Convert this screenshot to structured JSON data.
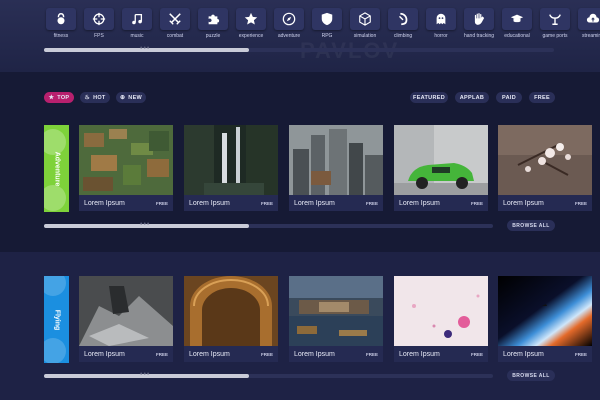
{
  "topbar": {
    "background_text": "PAVLOV",
    "categories": [
      {
        "label": "fitness",
        "icon": "kettlebell-icon"
      },
      {
        "label": "FPS",
        "icon": "crosshair-icon"
      },
      {
        "label": "music",
        "icon": "music-note-icon"
      },
      {
        "label": "combat",
        "icon": "swords-icon"
      },
      {
        "label": "puzzle",
        "icon": "puzzle-icon"
      },
      {
        "label": "experience",
        "icon": "star-icon"
      },
      {
        "label": "adventure",
        "icon": "compass-icon"
      },
      {
        "label": "RPG",
        "icon": "shield-icon"
      },
      {
        "label": "simulation",
        "icon": "cube-icon"
      },
      {
        "label": "climbing",
        "icon": "rope-icon"
      },
      {
        "label": "horror",
        "icon": "ghost-icon"
      },
      {
        "label": "hand tracking",
        "icon": "hand-icon"
      },
      {
        "label": "educational",
        "icon": "graduation-cap-icon"
      },
      {
        "label": "game ports",
        "icon": "gamepad-icon"
      },
      {
        "label": "streaming",
        "icon": "cloud-upload-icon"
      }
    ],
    "scroll_dots": "•••"
  },
  "filters": {
    "left": [
      {
        "label": "TOP",
        "icon": "star-icon",
        "active": true
      },
      {
        "label": "HOT",
        "icon": "flame-icon",
        "active": false
      },
      {
        "label": "NEW",
        "icon": "plus-circle-icon",
        "active": false
      }
    ],
    "right": [
      "FEATURED",
      "APPLAB",
      "PAID",
      "FREE"
    ]
  },
  "sections": [
    {
      "genre": "Adventure",
      "color": "#7ed23a",
      "browse_label": "BROWSE ALL",
      "cards": [
        {
          "title": "Lorem Ipsum",
          "badge": "FREE"
        },
        {
          "title": "Lorem Ipsum",
          "badge": "FREE"
        },
        {
          "title": "Lorem Ipsum",
          "badge": "FREE"
        },
        {
          "title": "Lorem Ipsum",
          "badge": "FREE"
        },
        {
          "title": "Lorem Ipsum",
          "badge": "FREE"
        }
      ]
    },
    {
      "genre": "Flying",
      "color": "#1b8fe0",
      "browse_label": "BROWSE ALL",
      "cards": [
        {
          "title": "Lorem Ipsum",
          "badge": "FREE"
        },
        {
          "title": "Lorem Ipsum",
          "badge": "FREE"
        },
        {
          "title": "Lorem Ipsum",
          "badge": "FREE"
        },
        {
          "title": "Lorem Ipsum",
          "badge": "FREE"
        },
        {
          "title": "Lorem Ipsum",
          "badge": "FREE"
        }
      ]
    }
  ],
  "colors": {
    "background": "#161a35",
    "accent": "#b8206e",
    "pill": "#2a2f58",
    "card": "#252a52"
  }
}
